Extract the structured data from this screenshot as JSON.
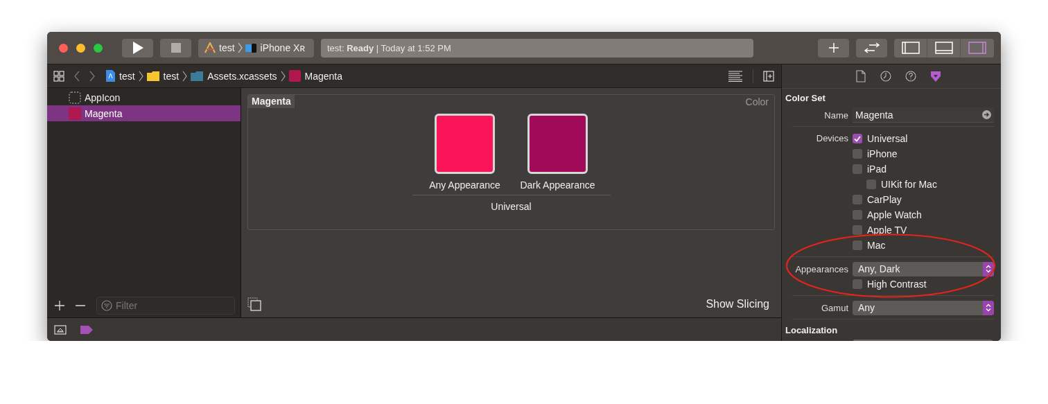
{
  "toolbar": {
    "run_button": {
      "kind": "run"
    },
    "stop_button": {
      "kind": "stop"
    },
    "scheme": {
      "name": "test",
      "device": "iPhone Xʀ"
    },
    "status": "test: **Ready** | Today at 1:52 PM",
    "panel_toggles": [
      {
        "kind": "navigator",
        "selected": false
      },
      {
        "kind": "debug",
        "selected": false
      },
      {
        "kind": "inspector",
        "selected": true
      }
    ]
  },
  "breadcrumbs": [
    {
      "kind": "project",
      "label": "test"
    },
    {
      "kind": "folder",
      "label": "test"
    },
    {
      "kind": "catalog",
      "label": "Assets.xcassets"
    },
    {
      "kind": "colorset",
      "label": "Magenta"
    }
  ],
  "navigator": {
    "items": [
      {
        "kind": "iconset",
        "label": "AppIcon",
        "selected": false
      },
      {
        "kind": "colorset",
        "label": "Magenta",
        "selected": true,
        "color": "#b0174f"
      }
    ],
    "filter": {
      "placeholder": "Filter"
    }
  },
  "editor": {
    "title": "Magenta",
    "type_label": "Color",
    "swatches": [
      {
        "label": "Any Appearance",
        "color": "#fc1459"
      },
      {
        "label": "Dark Appearance",
        "color": "#a10a58"
      }
    ],
    "group_label": "Universal",
    "slicing_button": "Show Slicing"
  },
  "inspector": {
    "tabs": [
      {
        "kind": "file",
        "selected": false
      },
      {
        "kind": "history",
        "selected": false
      },
      {
        "kind": "help",
        "selected": false
      },
      {
        "kind": "attributes",
        "selected": true
      }
    ],
    "section_title": "Color Set",
    "name": {
      "label": "Name",
      "value": "Magenta"
    },
    "devices": {
      "label": "Devices",
      "options": [
        {
          "label": "Universal",
          "checked": true
        },
        {
          "label": "iPhone",
          "checked": false
        },
        {
          "label": "iPad",
          "checked": false,
          "children": [
            {
              "label": "UIKit for Mac",
              "checked": false
            }
          ]
        },
        {
          "label": "CarPlay",
          "checked": false
        },
        {
          "label": "Apple Watch",
          "checked": false
        },
        {
          "label": "Apple TV",
          "checked": false
        },
        {
          "label": "Mac",
          "checked": false
        }
      ]
    },
    "appearances": {
      "label": "Appearances",
      "value": "Any, Dark",
      "options": [
        {
          "label": "High Contrast",
          "checked": false
        }
      ]
    },
    "gamut": {
      "label": "Gamut",
      "value": "Any"
    },
    "localization": {
      "title": "Localization"
    }
  },
  "annotation": {
    "kind": "ellipse",
    "color": "#e0251b"
  }
}
